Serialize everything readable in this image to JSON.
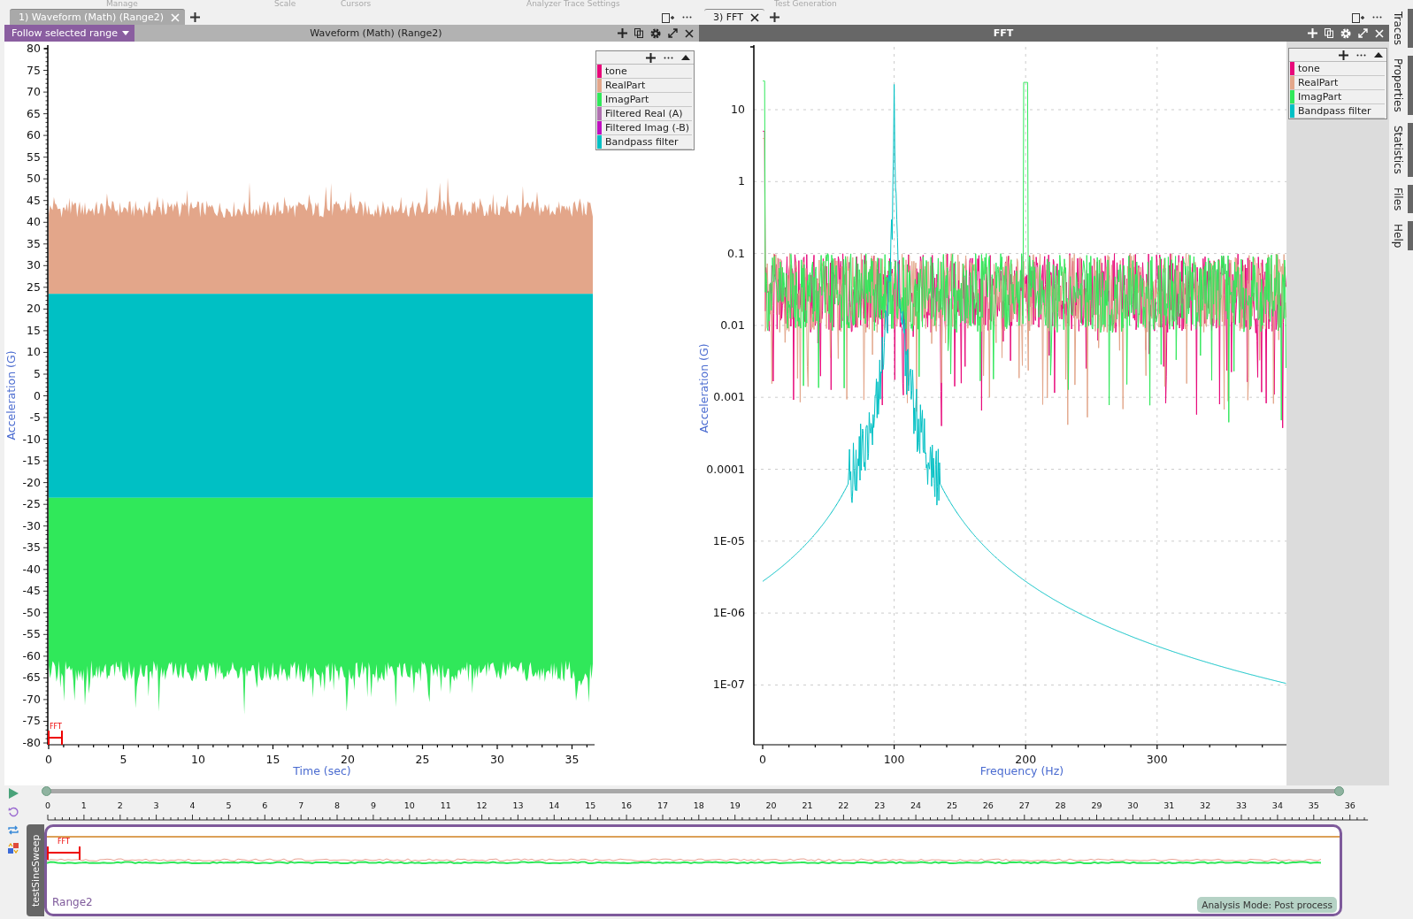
{
  "ribbon_groups": [
    "Manage",
    "Scale",
    "Cursors",
    "Analyzer Trace Settings",
    "Test Generation"
  ],
  "panels": [
    {
      "active": false,
      "tab": {
        "label": "1) Waveform (Math) (Range2)",
        "selected": true
      },
      "header": {
        "title": "Waveform (Math) (Range2)",
        "range_button": "Follow selected range"
      },
      "chart": {
        "kind": "waveform",
        "ylabel": "Acceleration (G)",
        "xlabel": "Time (sec)",
        "yticks": [
          "80",
          "75",
          "70",
          "65",
          "60",
          "55",
          "50",
          "45",
          "40",
          "35",
          "30",
          "25",
          "20",
          "15",
          "10",
          "5",
          "0",
          "-5",
          "-10",
          "-15",
          "-20",
          "-25",
          "-30",
          "-35",
          "-40",
          "-45",
          "-50",
          "-55",
          "-60",
          "-65",
          "-70",
          "-75",
          "-80"
        ],
        "xticks": [
          "0",
          "5",
          "10",
          "15",
          "20",
          "25",
          "30",
          "35"
        ],
        "marker": "FFT"
      },
      "legend": [
        {
          "name": "tone",
          "color": "#e8087a"
        },
        {
          "name": "RealPart",
          "color": "#e3a68a"
        },
        {
          "name": "ImagPart",
          "color": "#30e85a"
        },
        {
          "name": "Filtered Real (A)",
          "color": "#b070b0"
        },
        {
          "name": "Filtered Imag (-B)",
          "color": "#c010c0"
        },
        {
          "name": "Bandpass filter",
          "color": "#00c0c4"
        }
      ]
    },
    {
      "active": true,
      "tab": {
        "label": "3) FFT",
        "selected": true
      },
      "header": {
        "title": "FFT"
      },
      "chart": {
        "kind": "fft",
        "ylabel": "Acceleration (G)",
        "xlabel": "Frequency (Hz)",
        "yticks": [
          "10",
          "1",
          "0.1",
          "0.01",
          "0.001",
          "0.0001",
          "1E-05",
          "1E-06",
          "1E-07"
        ],
        "xticks": [
          "0",
          "100",
          "200",
          "300"
        ]
      },
      "legend": [
        {
          "name": "tone",
          "color": "#e8087a"
        },
        {
          "name": "RealPart",
          "color": "#e3a68a"
        },
        {
          "name": "ImagPart",
          "color": "#30e85a"
        },
        {
          "name": "Bandpass filter",
          "color": "#00c0c4"
        }
      ]
    }
  ],
  "sidebar_tabs": [
    "Traces",
    "Properties",
    "Statistics",
    "Files",
    "Help"
  ],
  "timeline": {
    "ticks": [
      "0",
      "1",
      "2",
      "3",
      "4",
      "5",
      "6",
      "7",
      "8",
      "9",
      "10",
      "11",
      "12",
      "13",
      "14",
      "15",
      "16",
      "17",
      "18",
      "19",
      "20",
      "21",
      "22",
      "23",
      "24",
      "25",
      "26",
      "27",
      "28",
      "29",
      "30",
      "31",
      "32",
      "33",
      "34",
      "35",
      "36"
    ],
    "track_label": "testSineSweep",
    "range_label": "Range2",
    "marker": "FFT",
    "mode_badge": "Analysis Mode: Post process"
  }
}
